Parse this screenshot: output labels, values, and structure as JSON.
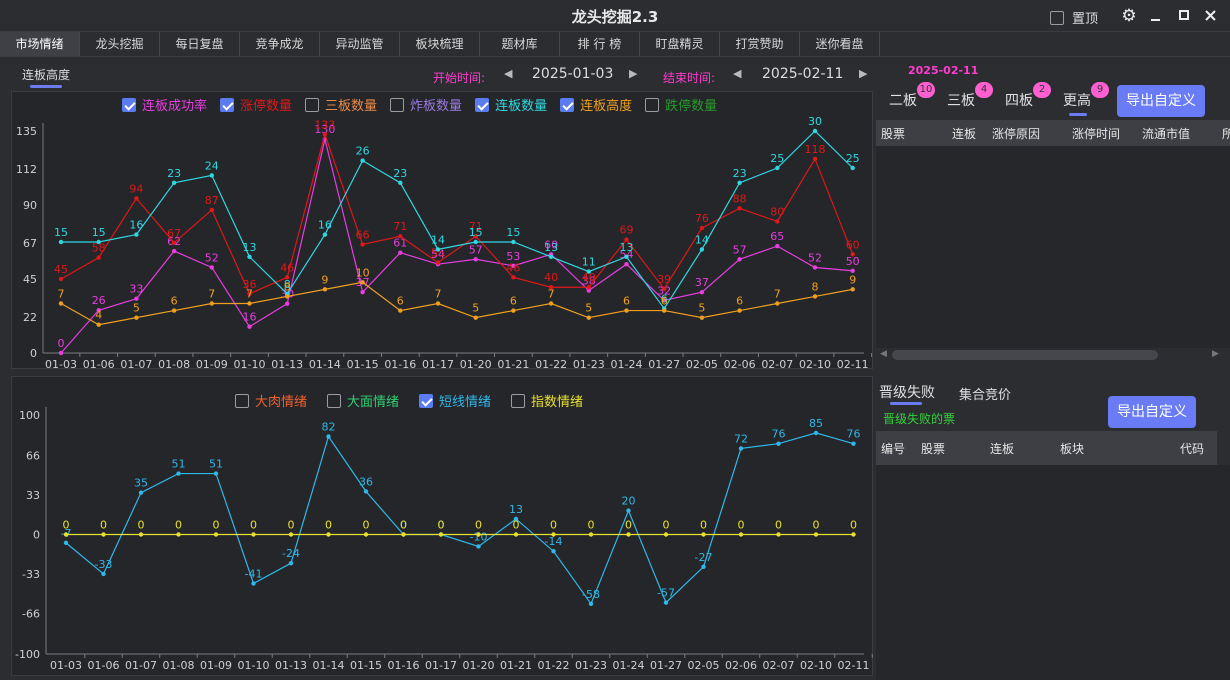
{
  "app": {
    "title": "龙头挖掘2.3",
    "pin_label": "置顶"
  },
  "tabs": [
    "市场情绪",
    "龙头挖掘",
    "每日复盘",
    "竞争成龙",
    "异动监管",
    "板块梳理",
    "题材库",
    "排 行 榜",
    "盯盘精灵",
    "打赏赞助",
    "迷你看盘"
  ],
  "active_tab": 0,
  "subtab": "连板高度",
  "range": {
    "start_label": "开始时间:",
    "start": "2025-01-03",
    "end_label": "结束时间:",
    "end": "2025-02-11"
  },
  "chart1": {
    "legend": [
      {
        "label": "连板成功率",
        "checked": true,
        "color": "#e83ee0"
      },
      {
        "label": "涨停数量",
        "checked": true,
        "color": "#e01818"
      },
      {
        "label": "三板数量",
        "checked": false,
        "color": "#e88a4a"
      },
      {
        "label": "炸板数量",
        "checked": false,
        "color": "#9a7ae0"
      },
      {
        "label": "连板数量",
        "checked": true,
        "color": "#2fd8e0"
      },
      {
        "label": "连板高度",
        "checked": true,
        "color": "#f0a020"
      },
      {
        "label": "跌停数量",
        "checked": false,
        "color": "#2a9a2a"
      }
    ]
  },
  "chart2": {
    "legend": [
      {
        "label": "大肉情绪",
        "checked": false,
        "color": "#f06030"
      },
      {
        "label": "大面情绪",
        "checked": false,
        "color": "#30d070"
      },
      {
        "label": "短线情绪",
        "checked": true,
        "color": "#30b8e8"
      },
      {
        "label": "指数情绪",
        "checked": false,
        "color": "#e8e030"
      }
    ]
  },
  "chart_data": [
    {
      "type": "line",
      "categories": [
        "01-03",
        "01-06",
        "01-07",
        "01-08",
        "01-09",
        "01-10",
        "01-13",
        "01-14",
        "01-15",
        "01-16",
        "01-17",
        "01-20",
        "01-21",
        "01-22",
        "01-23",
        "01-24",
        "01-27",
        "02-05",
        "02-06",
        "02-07",
        "02-10",
        "02-11"
      ],
      "ylim": [
        0,
        135
      ],
      "yticks": [
        0,
        22,
        45,
        67,
        90,
        112,
        135
      ],
      "series": [
        {
          "name": "连板成功率",
          "color": "#e83ee0",
          "values": [
            0,
            26,
            33,
            62,
            52,
            16,
            30,
            130,
            37,
            61,
            54,
            57,
            53,
            60,
            38,
            54,
            32,
            37,
            57,
            65,
            52,
            50
          ]
        },
        {
          "name": "涨停数量",
          "color": "#e01818",
          "values": [
            45,
            58,
            94,
            67,
            87,
            36,
            46,
            133,
            66,
            71,
            55,
            71,
            46,
            40,
            40,
            69,
            39,
            76,
            88,
            80,
            118,
            60
          ]
        },
        {
          "name": "连板数量",
          "color": "#2fd8e0",
          "values": [
            15,
            15,
            16,
            23,
            24,
            13,
            8,
            16,
            26,
            23,
            14,
            15,
            15,
            13,
            11,
            13,
            6,
            14,
            23,
            25,
            30,
            25
          ]
        },
        {
          "name": "连板高度",
          "color": "#f0a020",
          "values": [
            7,
            4,
            5,
            6,
            7,
            7,
            8,
            9,
            10,
            6,
            7,
            5,
            6,
            7,
            5,
            6,
            6,
            5,
            6,
            7,
            8,
            9
          ]
        }
      ],
      "scale_note": "连板数量 and 连板高度 are drawn on a secondary scale (labels show raw values)"
    },
    {
      "type": "line",
      "categories": [
        "01-03",
        "01-06",
        "01-07",
        "01-08",
        "01-09",
        "01-10",
        "01-13",
        "01-14",
        "01-15",
        "01-16",
        "01-17",
        "01-20",
        "01-21",
        "01-22",
        "01-23",
        "01-24",
        "01-27",
        "02-05",
        "02-06",
        "02-07",
        "02-10",
        "02-11"
      ],
      "ylim": [
        -100,
        100
      ],
      "yticks": [
        100,
        66,
        33,
        0,
        -33,
        -66,
        -100
      ],
      "series": [
        {
          "name": "短线情绪",
          "color": "#30b8e8",
          "values": [
            -7,
            -33,
            35,
            51,
            51,
            -41,
            -24,
            82,
            36,
            0,
            0,
            -10,
            13,
            -14,
            -58,
            20,
            -57,
            -27,
            72,
            76,
            85,
            76
          ]
        },
        {
          "name": "指数情绪",
          "color": "#e8e030",
          "values": [
            0,
            0,
            0,
            0,
            0,
            0,
            0,
            0,
            0,
            0,
            0,
            0,
            0,
            0,
            0,
            0,
            0,
            0,
            0,
            0,
            0,
            0
          ]
        }
      ]
    }
  ],
  "right": {
    "date": "2025-02-11",
    "tabs": [
      {
        "label": "二板",
        "badge": "10"
      },
      {
        "label": "三板",
        "badge": "4"
      },
      {
        "label": "四板",
        "badge": "2"
      },
      {
        "label": "更高",
        "badge": "9"
      }
    ],
    "export_label": "导出自定义",
    "table1_headers": [
      "股票",
      "连板",
      "涨停原因",
      "涨停时间",
      "流通市值",
      "所"
    ],
    "fail_title": "晋级失败",
    "auction_label": "集合竞价",
    "fail_sub": "晋级失败的票",
    "export2_label": "导出自定义",
    "table2_headers": [
      "编号",
      "股票",
      "连板",
      "板块",
      "代码"
    ]
  }
}
